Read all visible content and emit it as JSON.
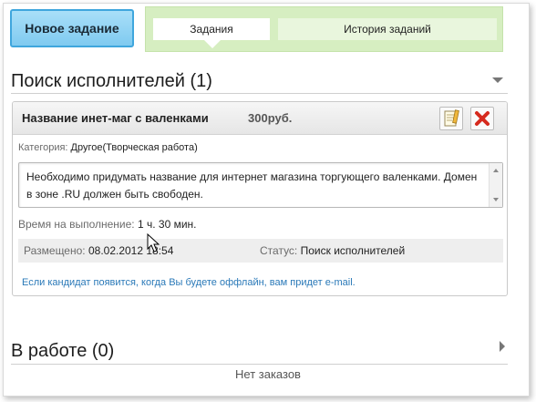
{
  "header": {
    "new_task_label": "Новое задание",
    "tabs": [
      {
        "label": "Задания",
        "active": true
      },
      {
        "label": "История заданий",
        "active": false
      }
    ]
  },
  "search_section": {
    "title": "Поиск исполнителей (1)",
    "collapsed": false
  },
  "task": {
    "title": "Название инет-маг с валенками",
    "price": "300руб.",
    "category_label": "Категория:",
    "category_value": "Другое(Творческая работа)",
    "description": "Необходимо придумать название для интернет магазина торгующего валенками. Домен в зоне .RU должен быть свободен.",
    "time_label": "Время на выполнение:",
    "time_value": "1 ч. 30 мин.",
    "placed_label": "Размещено:",
    "placed_value": "08.02.2012 18:54",
    "status_label": "Статус:",
    "status_value": "Поиск исполнителей",
    "notice": "Если кандидат появится, когда Вы будете оффлайн, вам придет e-mail.",
    "icons": [
      "edit-icon",
      "delete-icon"
    ]
  },
  "work_section": {
    "title": "В работе (0)",
    "empty_text": "Нет заказов"
  },
  "colors": {
    "accent_blue": "#7fcaf0",
    "tab_green": "#d6eec1",
    "delete_red": "#d62a1e",
    "link_blue": "#2a79b8"
  }
}
